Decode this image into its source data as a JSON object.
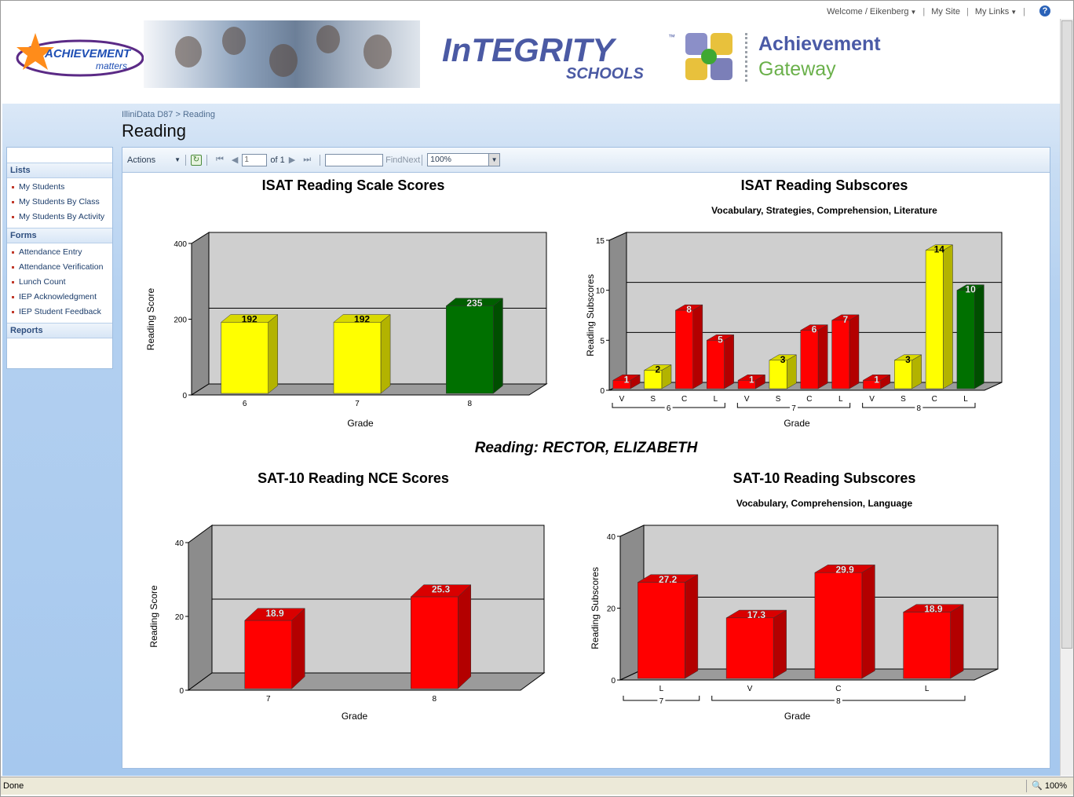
{
  "topbar": {
    "welcome": "Welcome / Eikenberg",
    "my_site": "My Site",
    "my_links": "My Links"
  },
  "banner": {
    "achievement_logo_line1": "ACHIEVEMENT",
    "achievement_logo_line2": "matters",
    "integrity_word": "InTEGRITY",
    "schools_word": "SCHOOLS",
    "tm": "™",
    "gateway_line1": "Achievement",
    "gateway_line2": "Gateway"
  },
  "breadcrumb": "IlliniData D87 > Reading",
  "page_title": "Reading",
  "sidebar": {
    "sections": [
      {
        "heading": "Lists",
        "items": [
          "My Students",
          "My Students By Class",
          "My Students By Activity"
        ]
      },
      {
        "heading": "Forms",
        "items": [
          "Attendance Entry",
          "Attendance Verification",
          "Lunch Count",
          "IEP Acknowledgment",
          "IEP Student Feedback"
        ]
      },
      {
        "heading": "Reports",
        "items": []
      }
    ]
  },
  "toolbar": {
    "actions": "Actions",
    "page_value": "1",
    "page_of": "of 1",
    "find_value": "",
    "find_next": "FindNext",
    "zoom": "100%"
  },
  "student_heading": "Reading:  RECTOR, ELIZABETH",
  "colors": {
    "yellow": "#ffff00",
    "green": "#007000",
    "red": "#ff0000"
  },
  "chart_data": [
    {
      "type": "bar",
      "title": "ISAT Reading Scale Scores",
      "xlabel": "Grade",
      "ylabel": "Reading Score",
      "ylim": [
        0,
        400
      ],
      "yticks": [
        0,
        200,
        400
      ],
      "categories": [
        "6",
        "7",
        "8"
      ],
      "values": [
        192,
        192,
        235
      ],
      "bar_colors": [
        "yellow",
        "yellow",
        "green"
      ],
      "grid": true
    },
    {
      "type": "bar",
      "title": "ISAT Reading Subscores",
      "subtitle": "Vocabulary, Strategies, Comprehension, Literature",
      "xlabel": "Grade",
      "ylabel": "Reading Subscores",
      "ylim": [
        0,
        15
      ],
      "yticks": [
        0,
        5,
        10,
        15
      ],
      "categories": [
        "V",
        "S",
        "C",
        "L",
        "V",
        "S",
        "C",
        "L",
        "V",
        "S",
        "C",
        "L"
      ],
      "groups": [
        {
          "label": "6",
          "size": 4
        },
        {
          "label": "7",
          "size": 4
        },
        {
          "label": "8",
          "size": 4
        }
      ],
      "values": [
        1,
        2,
        8,
        5,
        1,
        3,
        6,
        7,
        1,
        3,
        14,
        10
      ],
      "bar_colors": [
        "red",
        "yellow",
        "red",
        "red",
        "red",
        "yellow",
        "red",
        "red",
        "red",
        "yellow",
        "yellow",
        "green"
      ],
      "grid": true
    },
    {
      "type": "bar",
      "title": "SAT-10 Reading NCE Scores",
      "xlabel": "Grade",
      "ylabel": "Reading Score",
      "ylim": [
        0,
        40
      ],
      "yticks": [
        0,
        20,
        40
      ],
      "categories": [
        "7",
        "8"
      ],
      "values": [
        18.9,
        25.3
      ],
      "bar_colors": [
        "red",
        "red"
      ],
      "grid": true
    },
    {
      "type": "bar",
      "title": "SAT-10 Reading Subscores",
      "subtitle": "Vocabulary, Comprehension, Language",
      "xlabel": "Grade",
      "ylabel": "Reading Subscores",
      "ylim": [
        0,
        40
      ],
      "yticks": [
        0,
        20,
        40
      ],
      "categories": [
        "L",
        "V",
        "C",
        "L"
      ],
      "groups": [
        {
          "label": "7",
          "size": 1
        },
        {
          "label": "8",
          "size": 3
        }
      ],
      "values": [
        27.2,
        17.3,
        29.9,
        18.9
      ],
      "bar_colors": [
        "red",
        "red",
        "red",
        "red"
      ],
      "grid": true
    }
  ],
  "statusbar": {
    "text": "Done",
    "zoom": "100%"
  }
}
